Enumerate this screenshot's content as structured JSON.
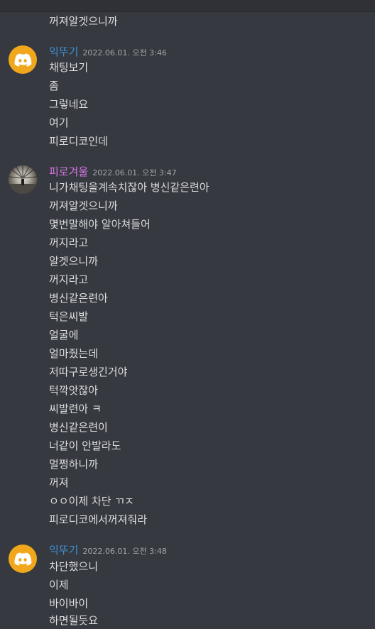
{
  "colors": {
    "background": "#36393f",
    "text": "#dcddde",
    "timestamp": "#a3a6aa",
    "user1_name": "#3d8fd6",
    "user2_name": "#d776e8",
    "discord_avatar": "#f0a71c"
  },
  "messages": {
    "top_continuation": "꺼져알겟으니까",
    "group1": {
      "username": "익뚜기",
      "timestamp": "2022.06.01. 오전 3:46",
      "avatar_icon": "discord-logo-icon",
      "lines": [
        "채팅보기",
        "좀",
        "그렇네요",
        "여기",
        "피로디코인데"
      ]
    },
    "group2": {
      "username": "피로겨울",
      "timestamp": "2022.06.01. 오전 3:47",
      "avatar_icon": "user-photo",
      "lines": [
        "니가채팅을계속치잖아 병신같은련아",
        "꺼져알겟으니까",
        "몇번말해야 알아쳐들어",
        "꺼지라고",
        "알겟으니까",
        "꺼지라고",
        "병신같은련아",
        "턱은씨발",
        "얼굴에",
        "얼마줬는데",
        "저따구로생긴거야",
        "턱깍앗잖아",
        "씨발련아 ㅋ",
        "병신같은련이",
        "너같이 안발라도",
        "멀쩡하니까",
        "꺼져",
        "ㅇㅇ이제 차단 ㄲㅈ",
        "피로디코에서꺼져줘라"
      ]
    },
    "group3": {
      "username": "익뚜기",
      "timestamp": "2022.06.01. 오전 3:48",
      "avatar_icon": "discord-logo-icon",
      "lines": [
        "차단했으니",
        "이제",
        "바이바이",
        "하면될듯요"
      ]
    }
  }
}
